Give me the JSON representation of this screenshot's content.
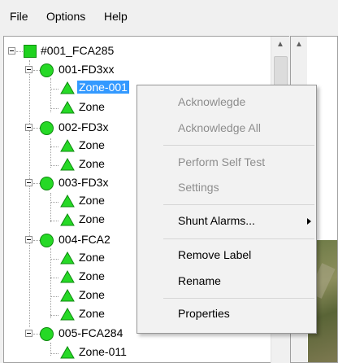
{
  "menu": {
    "file": "File",
    "options": "Options",
    "help": "Help"
  },
  "tree": {
    "root": "#001_FCA285",
    "nodes": [
      {
        "label": "001-FD3xx",
        "children": [
          "Zone-001",
          "Zone"
        ]
      },
      {
        "label": "002-FD3x",
        "children": [
          "Zone",
          "Zone"
        ]
      },
      {
        "label": "003-FD3x",
        "children": [
          "Zone",
          "Zone"
        ]
      },
      {
        "label": "004-FCA2",
        "children": [
          "Zone",
          "Zone",
          "Zone",
          "Zone"
        ]
      },
      {
        "label": "005-FCA284",
        "children": [
          "Zone-011"
        ]
      }
    ]
  },
  "context_menu": {
    "acknowledge": "Acknowlegde",
    "acknowledge_all": "Acknowledge All",
    "perform_self_test": "Perform Self Test",
    "settings": "Settings",
    "shunt_alarms": "Shunt Alarms...",
    "remove_label": "Remove Label",
    "rename": "Rename",
    "properties": "Properties"
  },
  "colors": {
    "status_ok": "#26d926",
    "selection": "#3399ff",
    "menu_disabled": "#8d8d8d"
  }
}
